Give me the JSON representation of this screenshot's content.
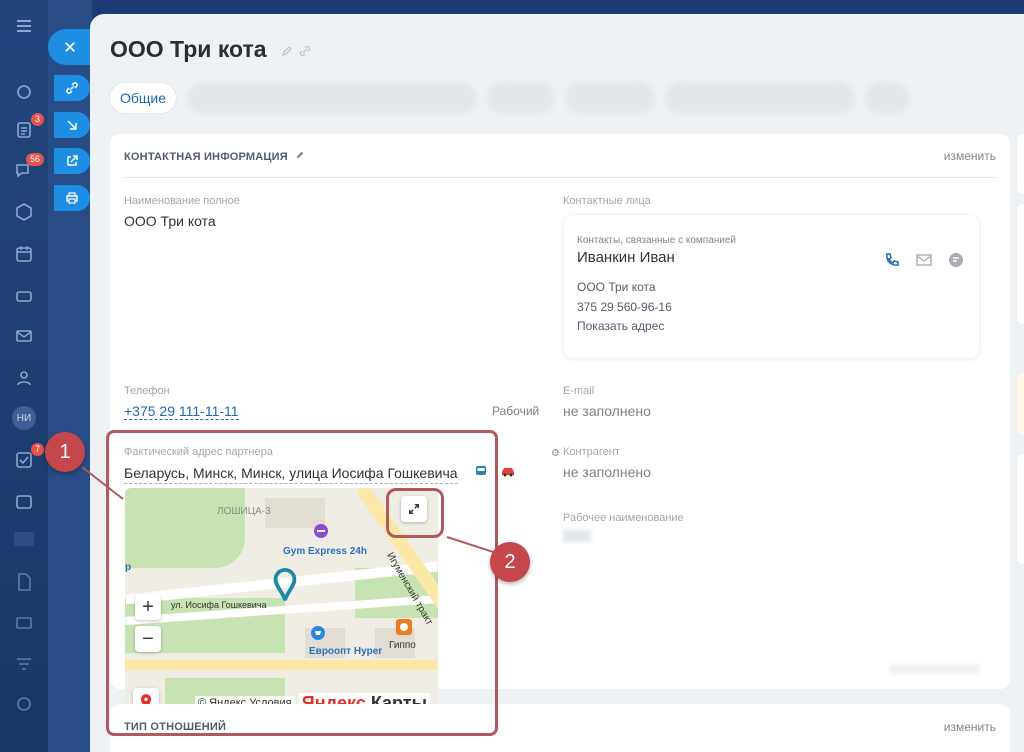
{
  "header": {
    "title": "ООО Три кота"
  },
  "tabs": [
    {
      "label": "Общие"
    }
  ],
  "sidebar": {
    "badges": [
      "3",
      "56",
      "7"
    ],
    "avatar_initials": "НИ"
  },
  "contact_section": {
    "title": "КОНТАКТНАЯ ИНФОРМАЦИЯ",
    "edit_label": "изменить"
  },
  "fields": {
    "full_name_label": "Наименование полное",
    "full_name_value": "ООО Три кота",
    "contact_persons_label": "Контактные лица",
    "phone_label": "Телефон",
    "phone_value": "+375 29 111-11-11",
    "phone_type": "Рабочий",
    "email_label": "E-mail",
    "email_value": "не заполнено",
    "address_label": "Фактический адрес партнера",
    "address_value": "Беларусь, Минск, Минск, улица Иосифа Гошкевича",
    "counterparty_label": "Контрагент",
    "counterparty_value": "не заполнено",
    "work_name_label": "Рабочее наименование"
  },
  "contact_card": {
    "subtitle": "Контакты, связанные с компанией",
    "name": "Иванкин Иван",
    "company": "ООО Три кота",
    "phone": "375 29 560-96-16",
    "show_address": "Показать адрес"
  },
  "map": {
    "labels": {
      "district": "ЛОШИЦА-3",
      "gym": "Gym Express 24h",
      "street": "ул. Иосифа Гошкевича",
      "shop1": "Евроопт Hyper",
      "shop2": "Гиппо",
      "road": "Игуменский тракт",
      "edge": "р"
    },
    "copyright": "© Яндекс",
    "terms": "Условия",
    "brand_prefix": "Яндекс",
    "brand_suffix": " Карты",
    "zoom_in": "+",
    "zoom_out": "−"
  },
  "relation_section": {
    "title": "ТИП ОТНОШЕНИЙ",
    "edit_label": "изменить"
  },
  "annotations": {
    "marker1": "1",
    "marker2": "2"
  }
}
